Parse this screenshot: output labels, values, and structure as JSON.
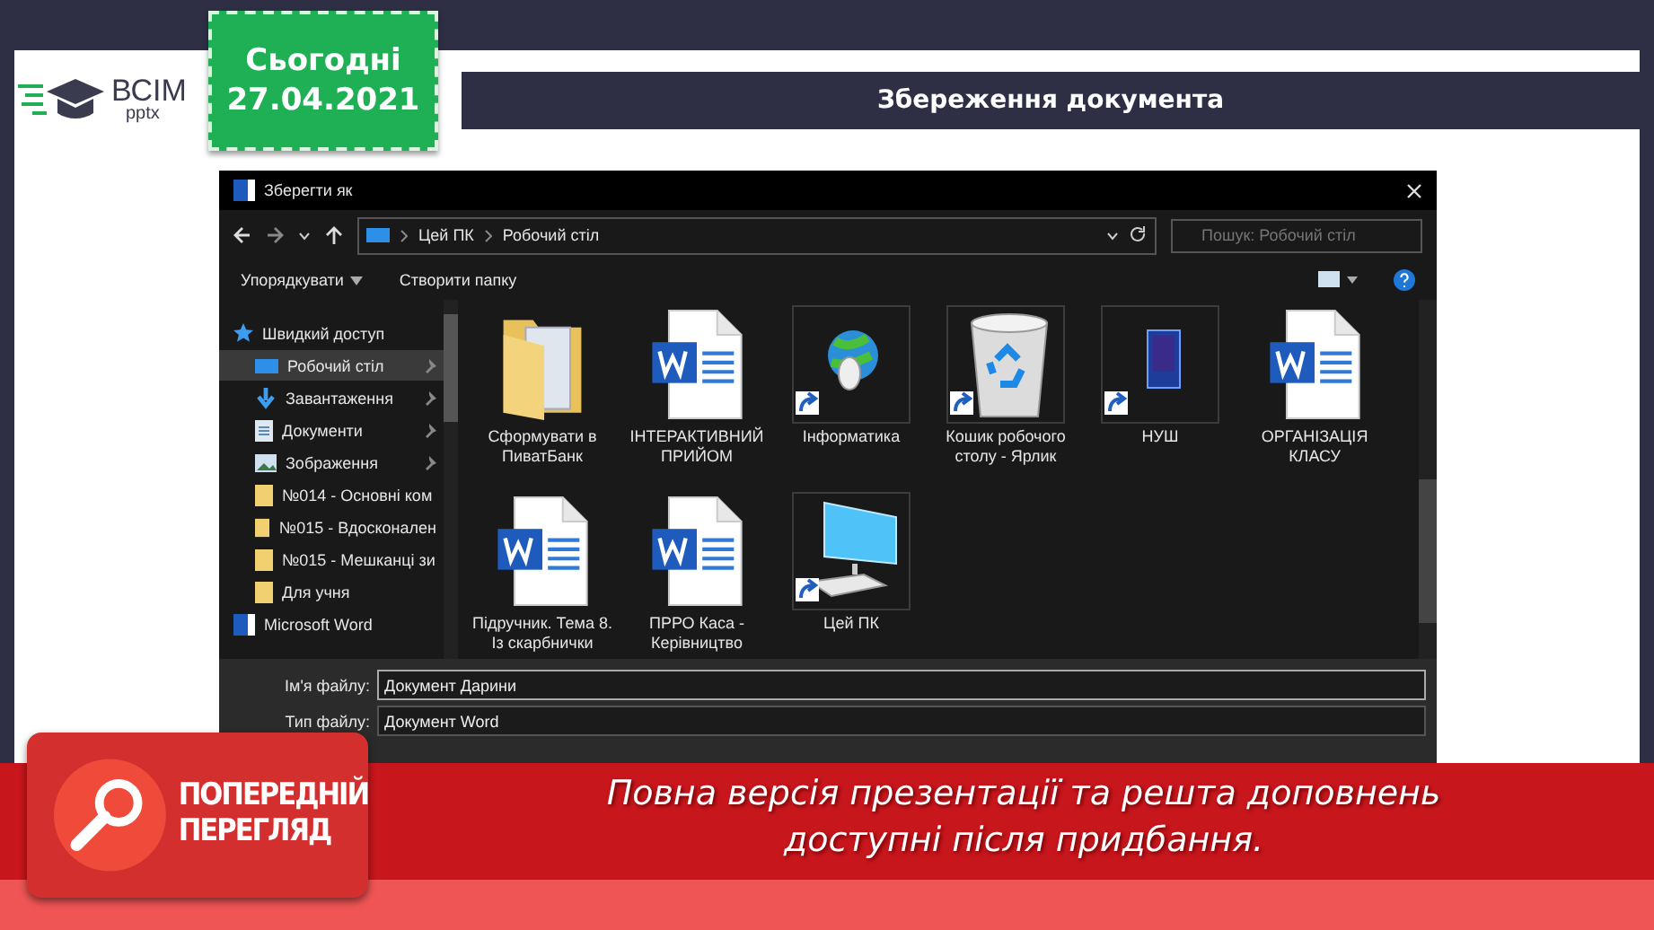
{
  "logo": {
    "text": "ВСІМ",
    "subtext": "pptx"
  },
  "date_sticker": {
    "line_1": "Сьогодні",
    "line_2": "27.04.2021"
  },
  "slide_title": "Збереження документа",
  "dialog": {
    "title": "Зберегти як",
    "path": [
      "Цей ПК",
      "Робочий стіл"
    ],
    "search": {
      "placeholder": "Пошук: Робочий стіл"
    },
    "toolbar": [
      "Упорядкувати",
      "Створити папку"
    ],
    "sidebar": [
      {
        "label": "Швидкий доступ",
        "kind": "star",
        "children": [
          {
            "label": "Робочий стіл",
            "kind": "desktop",
            "selected": true,
            "pinned": true
          },
          {
            "label": "Завантаження",
            "kind": "download",
            "selected": false,
            "pinned": true
          },
          {
            "label": "Документи",
            "kind": "documents",
            "selected": false,
            "pinned": true
          },
          {
            "label": "Зображення",
            "kind": "pictures",
            "selected": false,
            "pinned": true
          },
          {
            "label": "№014 - Основні ком",
            "kind": "folder",
            "selected": false,
            "pinned": false
          },
          {
            "label": "№015 - Вдосконален",
            "kind": "folder",
            "selected": false,
            "pinned": false
          },
          {
            "label": "№015 - Мешканці зи",
            "kind": "folder",
            "selected": false,
            "pinned": false
          },
          {
            "label": "Для учня",
            "kind": "folder",
            "selected": false,
            "pinned": false
          }
        ]
      },
      {
        "label": "Microsoft Word",
        "kind": "word"
      }
    ],
    "files": [
      {
        "label": "Сформувати в ПиватБанк",
        "kind": "folder"
      },
      {
        "label": "ІНТЕРАКТИВНИЙ ПРИЙОМ",
        "kind": "word"
      },
      {
        "label": "Інформатика",
        "kind": "globe-shortcut"
      },
      {
        "label": "Кошик робочого столу - Ярлик",
        "kind": "recycle-shortcut"
      },
      {
        "label": "НУШ",
        "kind": "book-shortcut"
      },
      {
        "label": "ОРГАНІЗАЦІЯ КЛАСУ",
        "kind": "word"
      },
      {
        "label": "Підручник. Тема 8. Із скарбнички",
        "kind": "word"
      },
      {
        "label": "ПРРО Каса - Керівництво",
        "kind": "word"
      },
      {
        "label": "Цей ПК",
        "kind": "pc-shortcut"
      }
    ],
    "file_name": {
      "label": "Ім'я файлу:",
      "value": "Документ Дарини"
    },
    "file_type": {
      "label": "Тип файлу:",
      "value": "Документ Word"
    }
  },
  "banner": {
    "badge": [
      "ПОПЕРЕДНІЙ",
      "ПЕРЕГЛЯД"
    ],
    "message": "Повна версія презентації та решта доповнень доступні після придбання."
  }
}
